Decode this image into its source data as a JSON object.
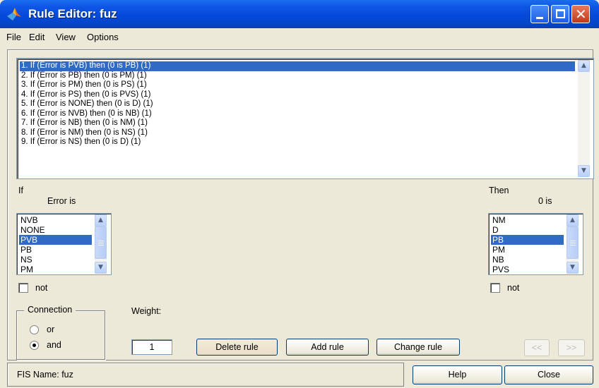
{
  "window": {
    "title": "Rule Editor: fuz"
  },
  "menu": [
    "File",
    "Edit",
    "View",
    "Options"
  ],
  "rules": [
    "1. If (Error is PVB) then (0 is PB) (1)",
    "2. If (Error is PB) then (0 is PM) (1)",
    "3. If (Error is PM) then (0 is PS) (1)",
    "4. If (Error is PS) then (0 is PVS) (1)",
    "5. If (Error is NONE) then (0 is D) (1)",
    "6. If (Error is NVB) then (0 is NB) (1)",
    "7. If (Error is NB) then (0 is NM) (1)",
    "8. If (Error is NM) then (0 is NS) (1)",
    "9. If (Error is NS) then (0 is D) (1)"
  ],
  "selected_rule_index": 0,
  "if_section": {
    "label": "If",
    "variable_label": "Error is",
    "options": [
      "NVB",
      "NONE",
      "PVB",
      "PB",
      "NS",
      "PM"
    ],
    "selected": "PVB",
    "not_label": "not",
    "not_checked": false
  },
  "then_section": {
    "label": "Then",
    "variable_label": "0 is",
    "options": [
      "NM",
      "D",
      "PB",
      "PM",
      "NB",
      "PVS"
    ],
    "selected": "PB",
    "not_label": "not",
    "not_checked": false
  },
  "connection": {
    "title": "Connection",
    "options": [
      "or",
      "and"
    ],
    "selected": "and"
  },
  "weight": {
    "label": "Weight:",
    "value": "1"
  },
  "buttons": {
    "delete_rule": "Delete rule",
    "add_rule": "Add rule",
    "change_rule": "Change rule",
    "prev": "<<",
    "next": ">>",
    "help": "Help",
    "close": "Close"
  },
  "status": "FIS Name: fuz",
  "colors": {
    "titlebar": "#0348d8",
    "selection": "#316ac5",
    "window_bg": "#ece9d8"
  }
}
